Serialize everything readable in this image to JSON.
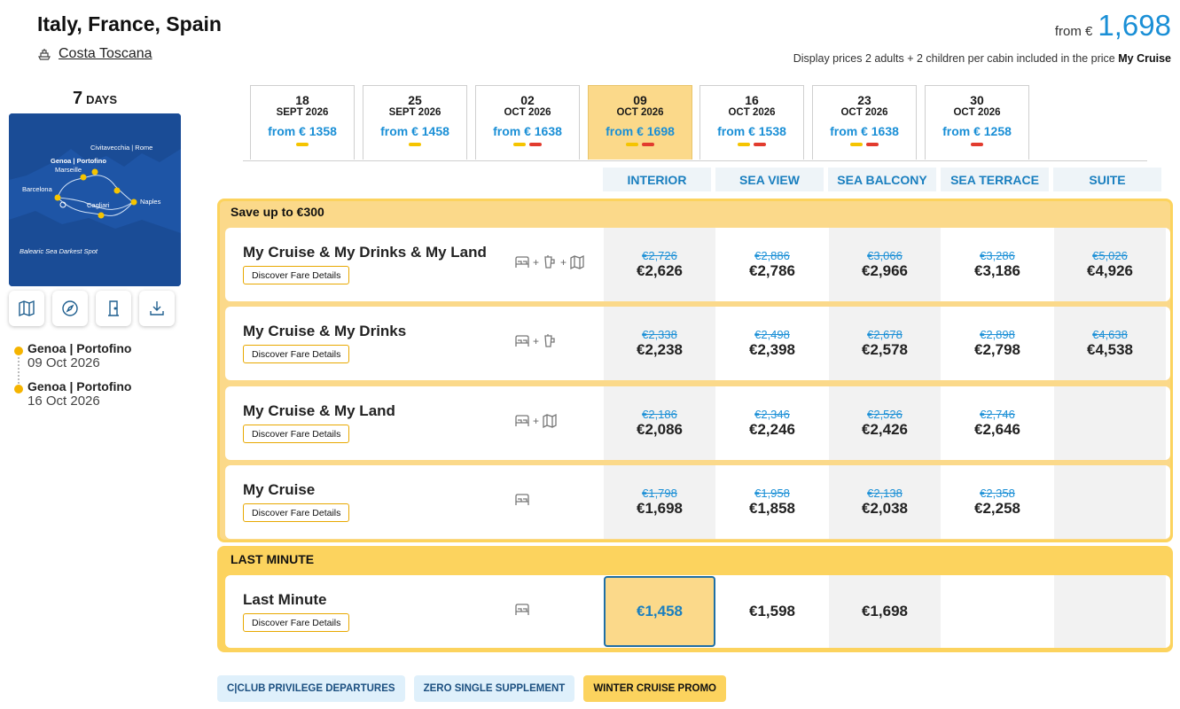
{
  "header": {
    "title": "Italy, France, Spain",
    "ship_name": "Costa Toscana",
    "price_from_label": "from €",
    "price_from_value": "1,698",
    "display_note": "Display prices 2 adults + 2 children per cabin included in the price",
    "display_note_fare": "My Cruise"
  },
  "sidebar": {
    "days_number": "7",
    "days_label": "DAYS",
    "map_labels": {
      "civitavecchia": "Civitavecchia | Rome",
      "genoa": "Genoa | Portofino",
      "marseille": "Marseille",
      "barcelona": "Barcelona",
      "naples": "Naples",
      "cagliari": "Cagliari",
      "balearic": "Balearic Sea Darkest Spot"
    },
    "tools": [
      {
        "icon": "map-icon"
      },
      {
        "icon": "compass-icon"
      },
      {
        "icon": "door-icon"
      },
      {
        "icon": "download-icon"
      }
    ],
    "itinerary": [
      {
        "port": "Genoa | Portofino",
        "date": "09 Oct 2026"
      },
      {
        "port": "Genoa | Portofino",
        "date": "16 Oct 2026"
      }
    ]
  },
  "date_tabs": [
    {
      "day": "18",
      "month": "SEPT 2026",
      "from": "from € 1358",
      "marks": [
        "yellow"
      ]
    },
    {
      "day": "25",
      "month": "SEPT 2026",
      "from": "from € 1458",
      "marks": [
        "yellow"
      ]
    },
    {
      "day": "02",
      "month": "OCT 2026",
      "from": "from € 1638",
      "marks": [
        "yellow",
        "red"
      ]
    },
    {
      "day": "09",
      "month": "OCT 2026",
      "from": "from € 1698",
      "marks": [
        "yellow",
        "red"
      ],
      "active": true
    },
    {
      "day": "16",
      "month": "OCT 2026",
      "from": "from € 1538",
      "marks": [
        "yellow",
        "red"
      ]
    },
    {
      "day": "23",
      "month": "OCT 2026",
      "from": "from € 1638",
      "marks": [
        "yellow",
        "red"
      ]
    },
    {
      "day": "30",
      "month": "OCT 2026",
      "from": "from € 1258",
      "marks": [
        "red"
      ]
    }
  ],
  "cabins": [
    "INTERIOR",
    "SEA VIEW",
    "SEA BALCONY",
    "SEA TERRACE",
    "SUITE"
  ],
  "groups": [
    {
      "title": "Save up to €300",
      "fares": [
        {
          "name": "My Cruise & My Drinks & My Land",
          "button": "Discover Fare Details",
          "icons": [
            "bed-icon",
            "drink-icon",
            "land-map-icon"
          ],
          "prices": [
            {
              "old": "€2,726",
              "new": "€2,626"
            },
            {
              "old": "€2,886",
              "new": "€2,786"
            },
            {
              "old": "€3,066",
              "new": "€2,966"
            },
            {
              "old": "€3,286",
              "new": "€3,186"
            },
            {
              "old": "€5,026",
              "new": "€4,926"
            }
          ]
        },
        {
          "name": "My Cruise & My Drinks",
          "button": "Discover Fare Details",
          "icons": [
            "bed-icon",
            "drink-icon"
          ],
          "prices": [
            {
              "old": "€2,338",
              "new": "€2,238"
            },
            {
              "old": "€2,498",
              "new": "€2,398"
            },
            {
              "old": "€2,678",
              "new": "€2,578"
            },
            {
              "old": "€2,898",
              "new": "€2,798"
            },
            {
              "old": "€4,638",
              "new": "€4,538"
            }
          ]
        },
        {
          "name": "My Cruise & My Land",
          "button": "Discover Fare Details",
          "icons": [
            "bed-icon",
            "land-map-icon"
          ],
          "prices": [
            {
              "old": "€2,186",
              "new": "€2,086"
            },
            {
              "old": "€2,346",
              "new": "€2,246"
            },
            {
              "old": "€2,526",
              "new": "€2,426"
            },
            {
              "old": "€2,746",
              "new": "€2,646"
            },
            null
          ]
        },
        {
          "name": "My Cruise",
          "button": "Discover Fare Details",
          "icons": [
            "bed-icon"
          ],
          "prices": [
            {
              "old": "€1,798",
              "new": "€1,698"
            },
            {
              "old": "€1,958",
              "new": "€1,858"
            },
            {
              "old": "€2,138",
              "new": "€2,038"
            },
            {
              "old": "€2,358",
              "new": "€2,258"
            },
            null
          ]
        }
      ]
    },
    {
      "title": "LAST MINUTE",
      "fares": [
        {
          "name": "Last Minute",
          "button": "Discover Fare Details",
          "icons": [
            "bed-icon"
          ],
          "prices": [
            {
              "old": "",
              "new": "€1,458",
              "selected": true
            },
            {
              "old": "",
              "new": "€1,598"
            },
            {
              "old": "",
              "new": "€1,698"
            },
            null,
            null
          ]
        }
      ]
    }
  ],
  "badges": [
    {
      "label": "C|CLUB PRIVILEGE DEPARTURES",
      "style": "blue"
    },
    {
      "label": "ZERO SINGLE SUPPLEMENT",
      "style": "blue"
    },
    {
      "label": "WINTER CRUISE PROMO",
      "style": "yellow"
    }
  ],
  "colors": {
    "accent_blue": "#1a8fd6",
    "promo_yellow": "#fcd35e",
    "soft_yellow": "#fbd98a",
    "map_blue": "#1e55a6"
  }
}
